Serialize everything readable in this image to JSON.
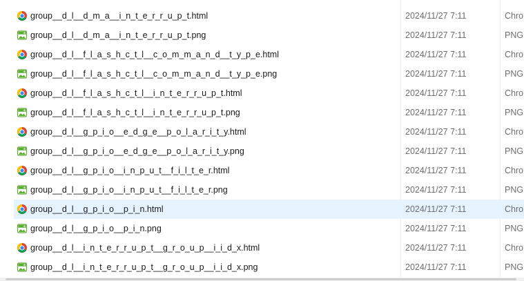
{
  "files": [
    {
      "name": "group__d_l__d_m_a__i_n_t_e_r_r_u_p_t.html",
      "date": "2024/11/27 7:11",
      "type": "Chro",
      "icon": "chrome-html-icon",
      "selected": false
    },
    {
      "name": "group__d_l__d_m_a__i_n_t_e_r_r_u_p_t.png",
      "date": "2024/11/27 7:11",
      "type": "PNG",
      "icon": "png-image-icon",
      "selected": false
    },
    {
      "name": "group__d_l__f_l_a_s_h_c_t_l__c_o_m_m_a_n_d__t_y_p_e.html",
      "date": "2024/11/27 7:11",
      "type": "Chro",
      "icon": "chrome-html-icon",
      "selected": false
    },
    {
      "name": "group__d_l__f_l_a_s_h_c_t_l__c_o_m_m_a_n_d__t_y_p_e.png",
      "date": "2024/11/27 7:11",
      "type": "PNG",
      "icon": "png-image-icon",
      "selected": false
    },
    {
      "name": "group__d_l__f_l_a_s_h_c_t_l__i_n_t_e_r_r_u_p_t.html",
      "date": "2024/11/27 7:11",
      "type": "Chro",
      "icon": "chrome-html-icon",
      "selected": false
    },
    {
      "name": "group__d_l__f_l_a_s_h_c_t_l__i_n_t_e_r_r_u_p_t.png",
      "date": "2024/11/27 7:11",
      "type": "PNG",
      "icon": "png-image-icon",
      "selected": false
    },
    {
      "name": "group__d_l__g_p_i_o__e_d_g_e__p_o_l_a_r_i_t_y.html",
      "date": "2024/11/27 7:11",
      "type": "Chro",
      "icon": "chrome-html-icon",
      "selected": false
    },
    {
      "name": "group__d_l__g_p_i_o__e_d_g_e__p_o_l_a_r_i_t_y.png",
      "date": "2024/11/27 7:11",
      "type": "PNG",
      "icon": "png-image-icon",
      "selected": false
    },
    {
      "name": "group__d_l__g_p_i_o__i_n_p_u_t__f_i_l_t_e_r.html",
      "date": "2024/11/27 7:11",
      "type": "Chro",
      "icon": "chrome-html-icon",
      "selected": false
    },
    {
      "name": "group__d_l__g_p_i_o__i_n_p_u_t__f_i_l_t_e_r.png",
      "date": "2024/11/27 7:11",
      "type": "PNG",
      "icon": "png-image-icon",
      "selected": false
    },
    {
      "name": "group__d_l__g_p_i_o__p_i_n.html",
      "date": "2024/11/27 7:11",
      "type": "Chro",
      "icon": "chrome-html-icon",
      "selected": true
    },
    {
      "name": "group__d_l__g_p_i_o__p_i_n.png",
      "date": "2024/11/27 7:11",
      "type": "PNG",
      "icon": "png-image-icon",
      "selected": false
    },
    {
      "name": "group__d_l__i_n_t_e_r_r_u_p_t__g_r_o_u_p__i_i_d_x.html",
      "date": "2024/11/27 7:11",
      "type": "Chro",
      "icon": "chrome-html-icon",
      "selected": false
    },
    {
      "name": "group__d_l__i_n_t_e_r_r_u_p_t__g_r_o_u_p__i_i_d_x.png",
      "date": "2024/11/27 7:11",
      "type": "PNG",
      "icon": "png-image-icon",
      "selected": false
    }
  ],
  "colors": {
    "selected_row": "#e5f3ff",
    "secondary_text": "#6d6d6d",
    "png_icon_green": "#5fae3a",
    "chrome_red": "#db4437",
    "chrome_yellow": "#f4c20d",
    "chrome_green": "#0f9d58",
    "chrome_blue": "#4285f4"
  }
}
